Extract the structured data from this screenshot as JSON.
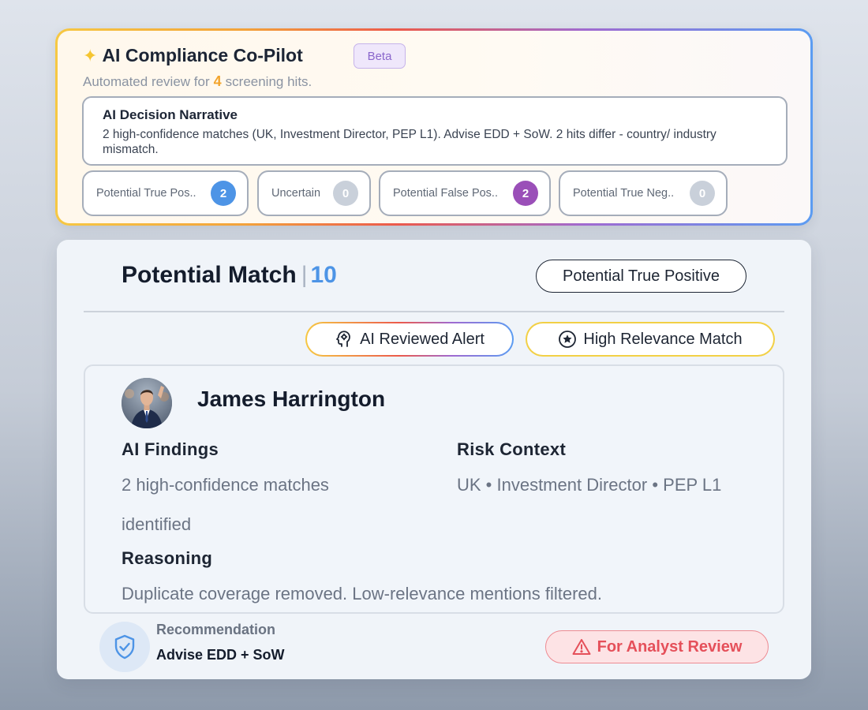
{
  "copilot": {
    "title": "AI Compliance Co-Pilot",
    "beta": "Beta",
    "subtitle_pre": "Automated review for",
    "hit_count": "4",
    "subtitle_post": "screening hits.",
    "narrative_title": "AI Decision Narrative",
    "narrative_body": "2 high-confidence matches (UK, Investment Director, PEP L1). Advise EDD + SoW. 2 hits differ - country/ industry mismatch.",
    "categories": [
      {
        "label": "Potential True Pos..",
        "count": "2",
        "color": "#4d94e6"
      },
      {
        "label": "Uncertain",
        "count": "0",
        "color": "#c9d0da"
      },
      {
        "label": "Potential False Pos..",
        "count": "2",
        "color": "#9a4fb8"
      },
      {
        "label": "Potential True Neg..",
        "count": "0",
        "color": "#c9d0da"
      }
    ]
  },
  "match": {
    "title": "Potential Match",
    "number": "10",
    "classification": "Potential True Positive",
    "chips": {
      "ai_reviewed": "AI Reviewed Alert",
      "high_relevance": "High Relevance Match"
    },
    "person": {
      "name": "James Harrington",
      "ai_findings_label": "AI Findings",
      "ai_findings_text": "2 high-confidence matches identified",
      "risk_context_label": "Risk Context",
      "risk_context_text": "UK • Investment Director • PEP L1",
      "reasoning_label": "Reasoning",
      "reasoning_text": "Duplicate coverage removed. Low-relevance mentions filtered."
    },
    "recommendation_label": "Recommendation",
    "recommendation_value": "Advise EDD + SoW",
    "review_status": "For Analyst Review"
  }
}
